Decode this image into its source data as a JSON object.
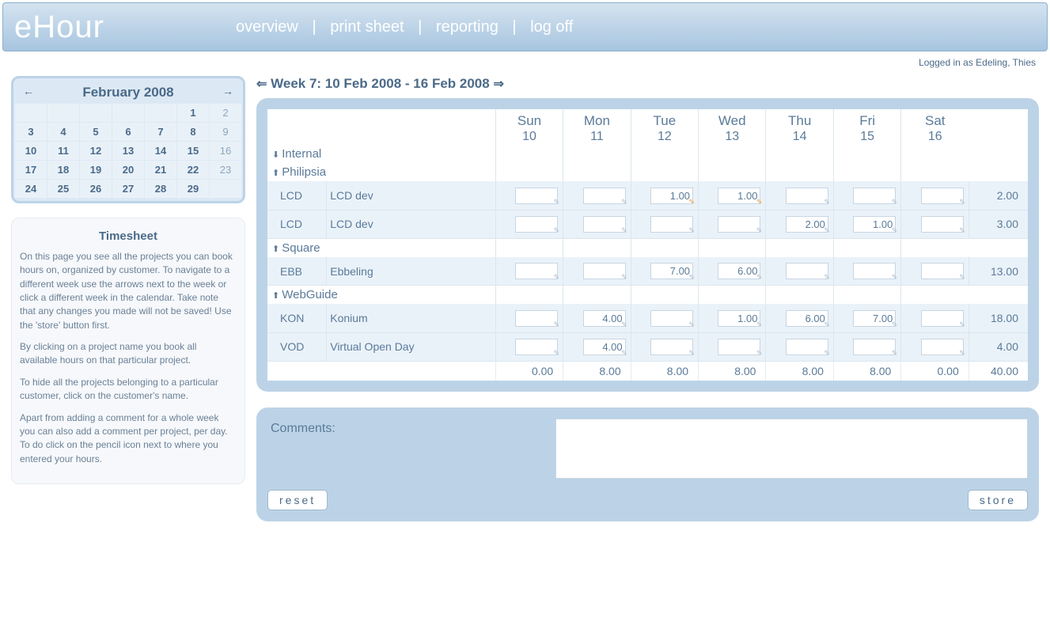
{
  "app": {
    "logo": "eHour"
  },
  "nav": {
    "overview": "overview",
    "print": "print sheet",
    "reporting": "reporting",
    "logoff": "log off"
  },
  "logged_in": "Logged in as Edeling, Thies",
  "calendar": {
    "title": "February 2008",
    "cells": [
      [
        "",
        "",
        "",
        "",
        "",
        "1",
        "2"
      ],
      [
        "3",
        "4",
        "5",
        "6",
        "7",
        "8",
        "9"
      ],
      [
        "10",
        "11",
        "12",
        "13",
        "14",
        "15",
        "16"
      ],
      [
        "17",
        "18",
        "19",
        "20",
        "21",
        "22",
        "23"
      ],
      [
        "24",
        "25",
        "26",
        "27",
        "28",
        "29",
        ""
      ]
    ],
    "dim_cols": [
      6
    ]
  },
  "help": {
    "title": "Timesheet",
    "p1": "On this page you see all the projects you can book hours on, organized by customer.",
    "p2": "To navigate to a different week use the arrows next to the week or click a different week in the calendar. Take note that any changes you made will not be saved! Use the 'store' button first.",
    "p3": "By clicking on a project name you book all available hours on that particular project.",
    "p4": "To hide all the projects belonging to a particular customer, click on the customer's name.",
    "p5": "Apart from adding a comment for a whole week you can also add a comment per project, per day. To do click on the pencil icon next to where you entered your hours."
  },
  "week": {
    "label": "Week 7: 10 Feb 2008 - 16 Feb 2008"
  },
  "days": [
    {
      "name": "Sun",
      "num": "10"
    },
    {
      "name": "Mon",
      "num": "11"
    },
    {
      "name": "Tue",
      "num": "12"
    },
    {
      "name": "Wed",
      "num": "13"
    },
    {
      "name": "Thu",
      "num": "14"
    },
    {
      "name": "Fri",
      "num": "15"
    },
    {
      "name": "Sat",
      "num": "16"
    }
  ],
  "groups": [
    {
      "name": "Internal",
      "dir": "down",
      "rows": []
    },
    {
      "name": "Philipsia",
      "dir": "up",
      "rows": [
        {
          "code": "LCD",
          "name": "LCD dev",
          "vals": [
            "",
            "",
            "1.00",
            "1.00",
            "",
            "",
            ""
          ],
          "hot": [
            2,
            3
          ],
          "total": "2.00"
        },
        {
          "code": "LCD",
          "name": "LCD dev",
          "vals": [
            "",
            "",
            "",
            "",
            "2.00",
            "1.00",
            ""
          ],
          "hot": [],
          "total": "3.00"
        }
      ]
    },
    {
      "name": "Square",
      "dir": "up",
      "rows": [
        {
          "code": "EBB",
          "name": "Ebbeling",
          "vals": [
            "",
            "",
            "7.00",
            "6.00",
            "",
            "",
            ""
          ],
          "hot": [],
          "total": "13.00"
        }
      ]
    },
    {
      "name": "WebGuide",
      "dir": "up",
      "rows": [
        {
          "code": "KON",
          "name": "Konium",
          "vals": [
            "",
            "4.00",
            "",
            "1.00",
            "6.00",
            "7.00",
            ""
          ],
          "hot": [],
          "total": "18.00"
        },
        {
          "code": "VOD",
          "name": "Virtual Open Day",
          "vals": [
            "",
            "4.00",
            "",
            "",
            "",
            "",
            ""
          ],
          "hot": [],
          "total": "4.00"
        }
      ]
    }
  ],
  "day_totals": [
    "0.00",
    "8.00",
    "8.00",
    "8.00",
    "8.00",
    "8.00",
    "0.00"
  ],
  "grand_total": "40.00",
  "comments": {
    "label": "Comments:",
    "value": ""
  },
  "buttons": {
    "reset": "reset",
    "store": "store"
  }
}
